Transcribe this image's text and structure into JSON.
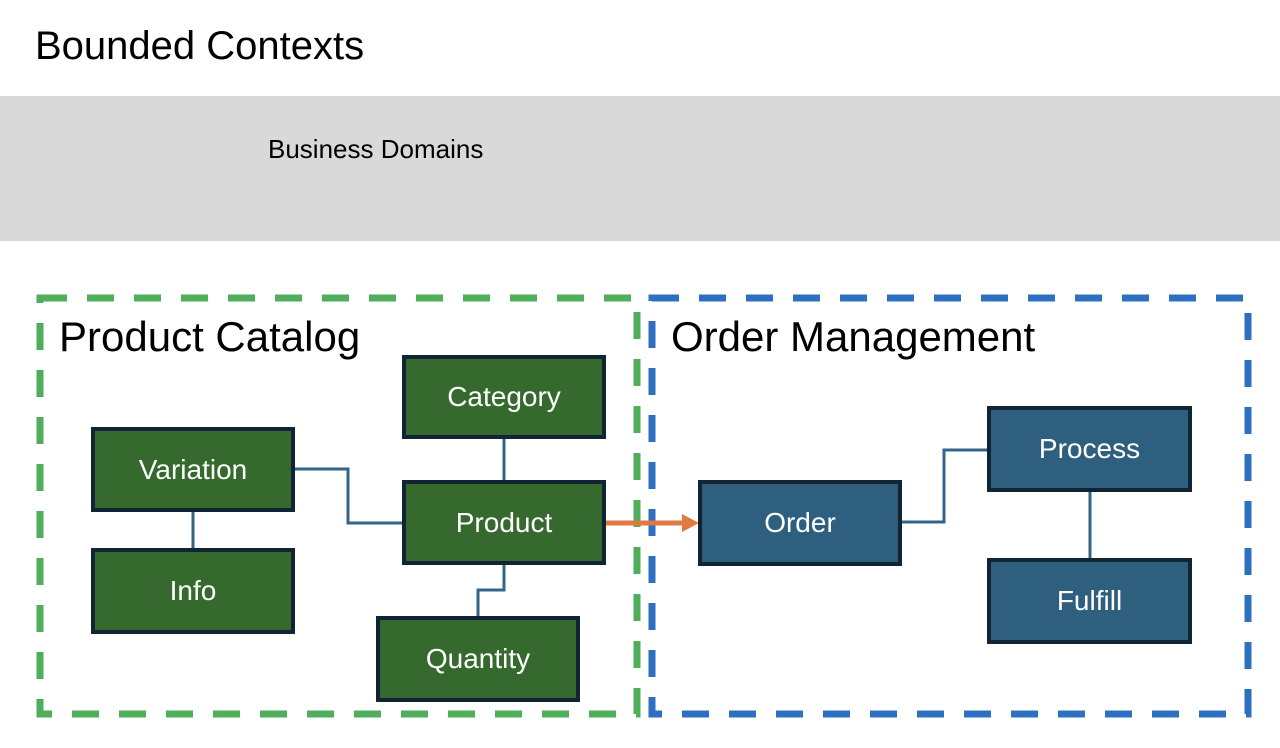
{
  "title": "Bounded Contexts",
  "band": {
    "label": "Business Domains"
  },
  "colors": {
    "band_bg": "#d9d9d9",
    "product_context_border": "#4fad5b",
    "order_context_border": "#2e6fbf",
    "product_node_fill": "#35692e",
    "order_node_fill": "#2f5f7e",
    "node_border": "#102433",
    "connector": "#336488",
    "cross_context_arrow": "#e07a3f"
  },
  "contexts": [
    {
      "name": "Product Catalog",
      "nodes": [
        "Category",
        "Variation",
        "Product",
        "Info",
        "Quantity"
      ]
    },
    {
      "name": "Order Management",
      "nodes": [
        "Order",
        "Process",
        "Fulfill"
      ]
    }
  ],
  "nodes": {
    "category": "Category",
    "variation": "Variation",
    "product": "Product",
    "info": "Info",
    "quantity": "Quantity",
    "order": "Order",
    "process": "Process",
    "fulfill": "Fulfill"
  },
  "edges": [
    {
      "from": "Variation",
      "to": "Product",
      "type": "line"
    },
    {
      "from": "Variation",
      "to": "Info",
      "type": "line"
    },
    {
      "from": "Category",
      "to": "Product",
      "type": "line"
    },
    {
      "from": "Product",
      "to": "Quantity",
      "type": "line"
    },
    {
      "from": "Product",
      "to": "Order",
      "type": "arrow"
    },
    {
      "from": "Order",
      "to": "Process",
      "type": "line"
    },
    {
      "from": "Process",
      "to": "Fulfill",
      "type": "line"
    }
  ]
}
